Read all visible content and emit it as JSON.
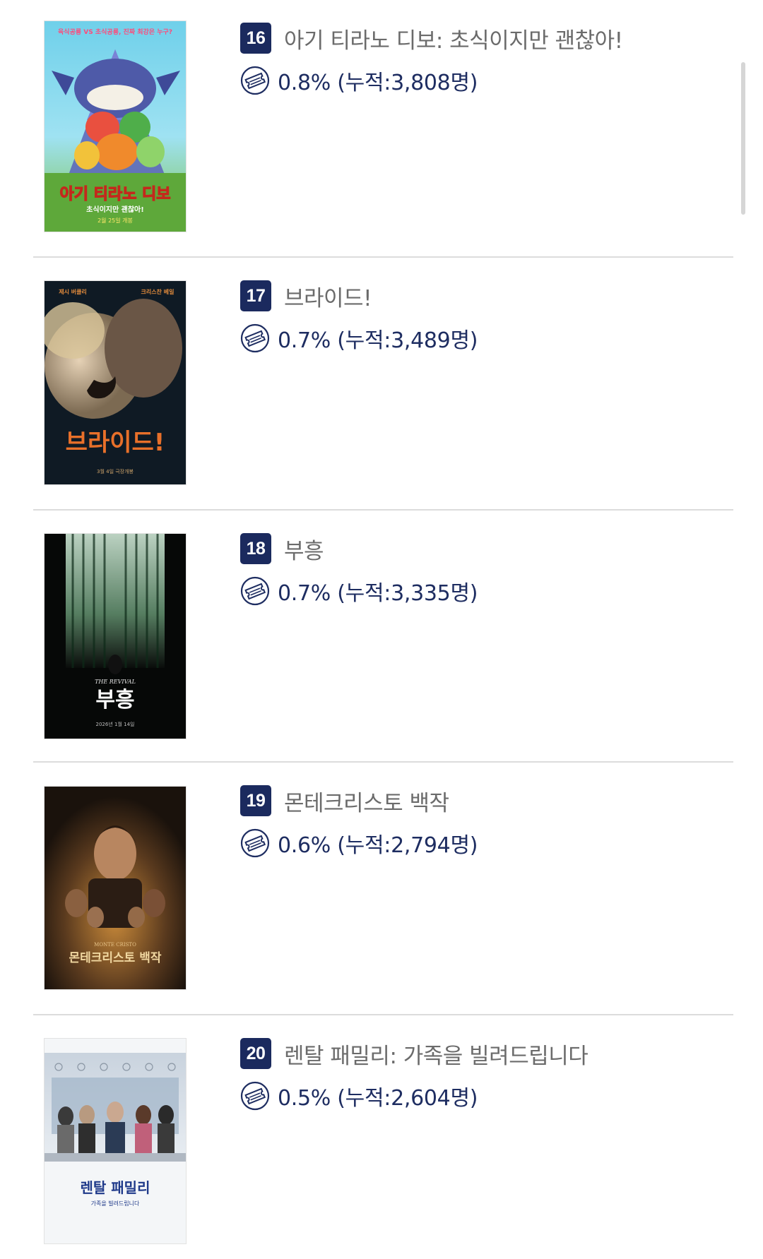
{
  "colors": {
    "accent_navy": "#1b2a5e",
    "title_gray": "#6b6b6b",
    "divider": "#dcdcdc"
  },
  "ticket_icon": "ticket-icon",
  "movies": [
    {
      "rank": "16",
      "title": "아기 티라노 디보: 초식이지만 괜찮아!",
      "stat": "0.8% (누적:3,808명)",
      "poster": {
        "top_text": "육식공룡 VS 초식공룡, 진짜 최강은 누구?",
        "title_text": "아기 티라노 디보",
        "tagline": "초식이지만 괜찮아!",
        "date": "2월 25일 개봉"
      }
    },
    {
      "rank": "17",
      "title": "브라이드!",
      "stat": "0.7% (누적:3,489명)",
      "poster": {
        "top_left": "제시 버클리",
        "top_right": "크리스찬 베일",
        "title_text": "브라이드!",
        "date": "3월 4일 극장개봉"
      }
    },
    {
      "rank": "18",
      "title": "부흥",
      "stat": "0.7% (누적:3,335명)",
      "poster": {
        "english_title": "THE REVIVAL",
        "title_text": "부흥",
        "date": "2026년 1월 14일"
      }
    },
    {
      "rank": "19",
      "title": "몬테크리스토 백작",
      "stat": "0.6% (누적:2,794명)",
      "poster": {
        "english_title": "MONTE CRISTO",
        "title_text": "몬테크리스토 백작"
      }
    },
    {
      "rank": "20",
      "title": "렌탈 패밀리: 가족을 빌려드립니다",
      "stat": "0.5% (누적:2,604명)",
      "poster": {
        "title_text": "렌탈 패밀리",
        "tagline": "가족을 빌려드립니다"
      }
    }
  ]
}
